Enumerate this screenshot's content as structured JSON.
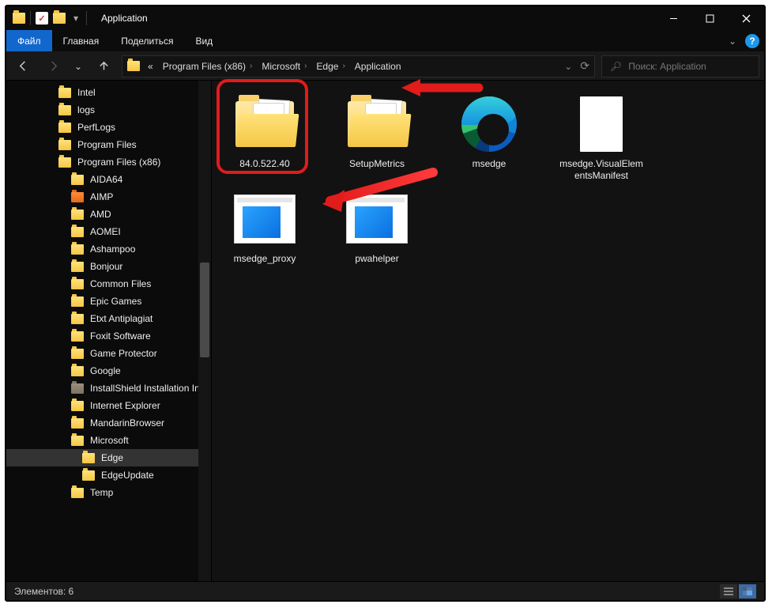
{
  "window": {
    "title": "Application"
  },
  "ribbon": {
    "file": "Файл",
    "tabs": [
      "Главная",
      "Поделиться",
      "Вид"
    ]
  },
  "breadcrumb": {
    "prefix": "«",
    "segments": [
      "Program Files (x86)",
      "Microsoft",
      "Edge",
      "Application"
    ]
  },
  "search": {
    "placeholder": "Поиск: Application"
  },
  "tree": [
    {
      "label": "Intel",
      "depth": 0
    },
    {
      "label": "logs",
      "depth": 0
    },
    {
      "label": "PerfLogs",
      "depth": 0
    },
    {
      "label": "Program Files",
      "depth": 0
    },
    {
      "label": "Program Files (x86)",
      "depth": 0
    },
    {
      "label": "AIDA64",
      "depth": 1
    },
    {
      "label": "AIMP",
      "depth": 1,
      "variant": "orange"
    },
    {
      "label": "AMD",
      "depth": 1
    },
    {
      "label": "AOMEI",
      "depth": 1
    },
    {
      "label": "Ashampoo",
      "depth": 1
    },
    {
      "label": "Bonjour",
      "depth": 1
    },
    {
      "label": "Common Files",
      "depth": 1
    },
    {
      "label": "Epic Games",
      "depth": 1
    },
    {
      "label": "Etxt Antiplagiat",
      "depth": 1
    },
    {
      "label": "Foxit Software",
      "depth": 1
    },
    {
      "label": "Game Protector",
      "depth": 1
    },
    {
      "label": "Google",
      "depth": 1
    },
    {
      "label": "InstallShield Installation Informat",
      "depth": 1,
      "variant": "gray"
    },
    {
      "label": "Internet Explorer",
      "depth": 1
    },
    {
      "label": "MandarinBrowser",
      "depth": 1
    },
    {
      "label": "Microsoft",
      "depth": 1
    },
    {
      "label": "Edge",
      "depth": 2,
      "selected": true
    },
    {
      "label": "EdgeUpdate",
      "depth": 2
    },
    {
      "label": "Temp",
      "depth": 1
    }
  ],
  "items": [
    {
      "name": "84.0.522.40",
      "type": "folder"
    },
    {
      "name": "SetupMetrics",
      "type": "folder"
    },
    {
      "name": "msedge",
      "type": "edge"
    },
    {
      "name": "msedge.VisualElementsManifest",
      "type": "doc"
    },
    {
      "name": "msedge_proxy",
      "type": "win"
    },
    {
      "name": "pwahelper",
      "type": "win"
    }
  ],
  "status": {
    "text": "Элементов: 6"
  }
}
